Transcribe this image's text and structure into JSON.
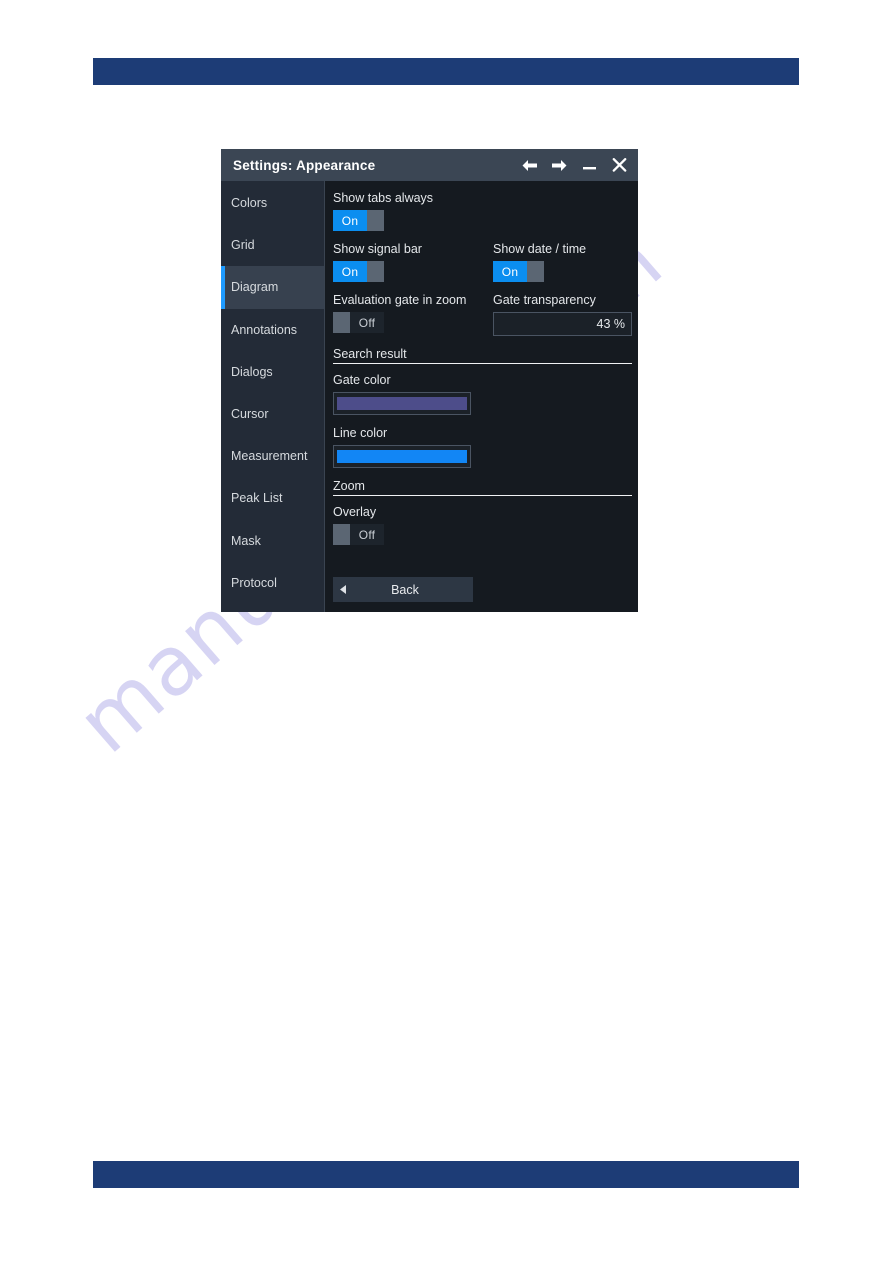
{
  "page": {
    "watermark": "manualshive.com",
    "bar_color": "#1d3c76"
  },
  "dialog": {
    "title": "Settings: Appearance",
    "titlebar_buttons": [
      {
        "name": "back-arrow-icon",
        "label": "←"
      },
      {
        "name": "forward-arrow-icon",
        "label": "→"
      },
      {
        "name": "minimize-icon",
        "label": "—"
      },
      {
        "name": "close-icon",
        "label": "✕"
      }
    ],
    "sidebar": {
      "items": [
        {
          "label": "Colors",
          "selected": false
        },
        {
          "label": "Grid",
          "selected": false
        },
        {
          "label": "Diagram",
          "selected": true
        },
        {
          "label": "Annotations",
          "selected": false
        },
        {
          "label": "Dialogs",
          "selected": false
        },
        {
          "label": "Cursor",
          "selected": false
        },
        {
          "label": "Measurement",
          "selected": false
        },
        {
          "label": "Peak List",
          "selected": false
        },
        {
          "label": "Mask",
          "selected": false
        },
        {
          "label": "Protocol",
          "selected": false
        }
      ],
      "accent_color": "#1e9bff"
    },
    "content": {
      "show_tabs_always": {
        "label": "Show tabs always",
        "value": "On",
        "state": "on"
      },
      "show_signal_bar": {
        "label": "Show signal bar",
        "value": "On",
        "state": "on"
      },
      "show_date_time": {
        "label": "Show date / time",
        "value": "On",
        "state": "on"
      },
      "evaluation_gate_in_zoom": {
        "label": "Evaluation gate in zoom",
        "value": "Off",
        "state": "off"
      },
      "gate_transparency": {
        "label": "Gate transparency",
        "value": "43 %"
      },
      "search_result_section": {
        "heading": "Search result"
      },
      "gate_color": {
        "label": "Gate color",
        "color": "#4d4d8a"
      },
      "line_color": {
        "label": "Line color",
        "color": "#1286f5"
      },
      "zoom_section": {
        "heading": "Zoom"
      },
      "overlay": {
        "label": "Overlay",
        "value": "Off",
        "state": "off"
      },
      "back_button": {
        "label": "Back"
      }
    }
  }
}
